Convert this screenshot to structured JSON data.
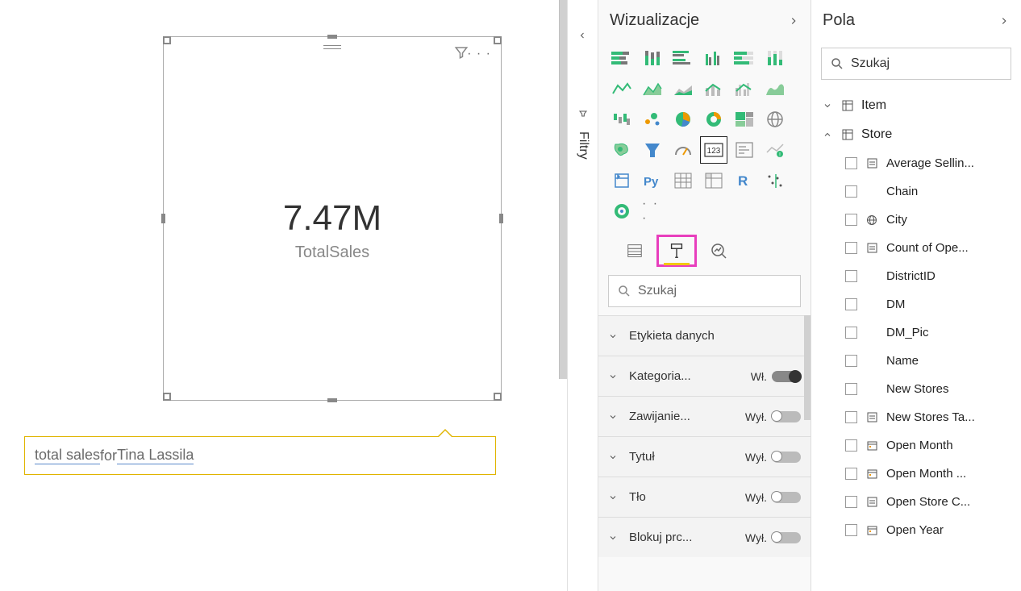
{
  "canvas": {
    "card_value": "7.47M",
    "card_label": "TotalSales",
    "more_dots": "· · ·"
  },
  "qna": {
    "part1": "total sales",
    "part2": " for ",
    "part3": "Tina Lassila"
  },
  "filters_tab": "Filtry",
  "viz_pane": {
    "title": "Wizualizacje",
    "search_placeholder": "Szukaj",
    "ellipsis": "· · ·",
    "icons": [
      "stacked-bar",
      "stacked-column",
      "clustered-bar",
      "clustered-column",
      "100-bar",
      "100-column",
      "line",
      "area",
      "stacked-area",
      "line-column",
      "line-clustered",
      "ribbon",
      "waterfall",
      "scatter",
      "pie",
      "donut",
      "treemap",
      "map",
      "filled-map",
      "funnel",
      "gauge",
      "card",
      "multi-card",
      "kpi",
      "slicer",
      "python",
      "table",
      "matrix",
      "r",
      "key-influencers",
      "arcgis"
    ],
    "props": [
      {
        "label": "Etykieta danych",
        "state": "",
        "on": null
      },
      {
        "label": "Kategoria...",
        "state": "Wł.",
        "on": true
      },
      {
        "label": "Zawijanie...",
        "state": "Wył.",
        "on": false
      },
      {
        "label": "Tytuł",
        "state": "Wył.",
        "on": false
      },
      {
        "label": "Tło",
        "state": "Wył.",
        "on": false
      },
      {
        "label": "Blokuj prc...",
        "state": "Wył.",
        "on": false
      }
    ]
  },
  "fields_pane": {
    "title": "Pola",
    "search_placeholder": "Szukaj",
    "tables": [
      {
        "name": "Item",
        "expanded": false
      },
      {
        "name": "Store",
        "expanded": true,
        "fields": [
          {
            "name": "Average Sellin...",
            "icon": "calc"
          },
          {
            "name": "Chain",
            "icon": ""
          },
          {
            "name": "City",
            "icon": "globe"
          },
          {
            "name": "Count of Ope...",
            "icon": "calc"
          },
          {
            "name": "DistrictID",
            "icon": ""
          },
          {
            "name": "DM",
            "icon": ""
          },
          {
            "name": "DM_Pic",
            "icon": ""
          },
          {
            "name": "Name",
            "icon": ""
          },
          {
            "name": "New Stores",
            "icon": ""
          },
          {
            "name": "New Stores Ta...",
            "icon": "calc"
          },
          {
            "name": "Open Month",
            "icon": "date"
          },
          {
            "name": "Open Month ...",
            "icon": "date"
          },
          {
            "name": "Open Store C...",
            "icon": "calc"
          },
          {
            "name": "Open Year",
            "icon": "date"
          }
        ]
      }
    ]
  }
}
